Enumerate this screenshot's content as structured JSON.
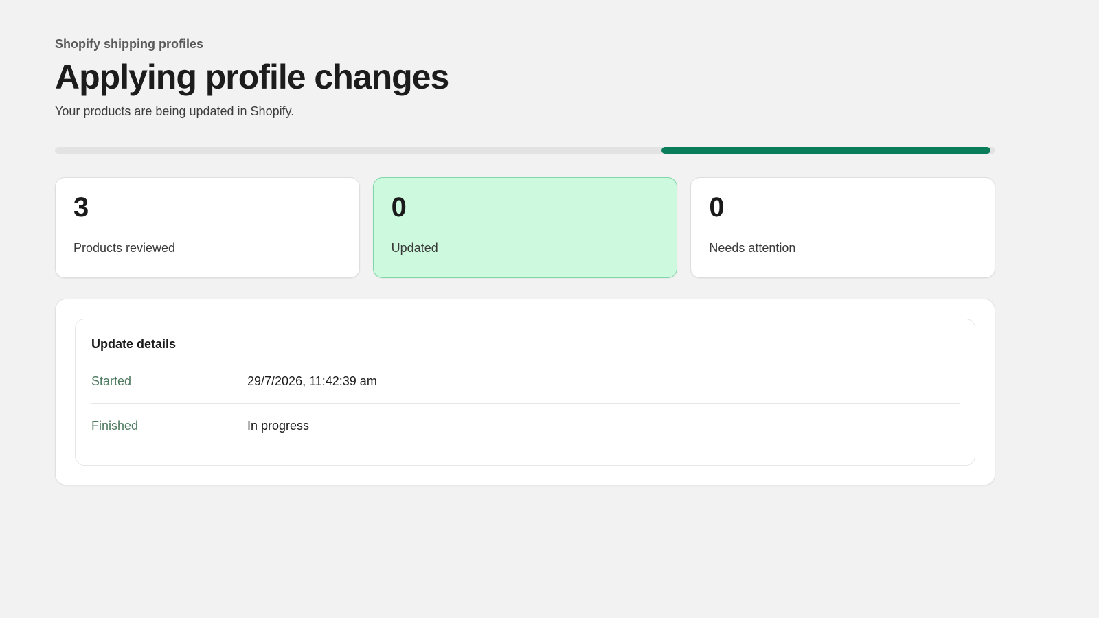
{
  "header": {
    "eyebrow": "Shopify shipping profiles",
    "title": "Applying profile changes",
    "subtitle": "Your products are being updated in Shopify."
  },
  "progress": {
    "start_fraction": 0.645,
    "end_fraction": 0.995,
    "color": "#0a7d5a"
  },
  "stats": [
    {
      "value": "3",
      "label": "Products reviewed"
    },
    {
      "value": "0",
      "label": "Updated"
    },
    {
      "value": "0",
      "label": "Needs attention"
    }
  ],
  "details": {
    "title": "Update details",
    "rows": [
      {
        "key": "Started",
        "value": "29/7/2026, 11:42:39 am"
      },
      {
        "key": "Finished",
        "value": "In progress"
      }
    ]
  },
  "colors": {
    "background": "#f2f2f2",
    "highlight_card": "#cdfadf",
    "accent": "#0a7d5a",
    "detail_key": "#4e7a5f"
  }
}
